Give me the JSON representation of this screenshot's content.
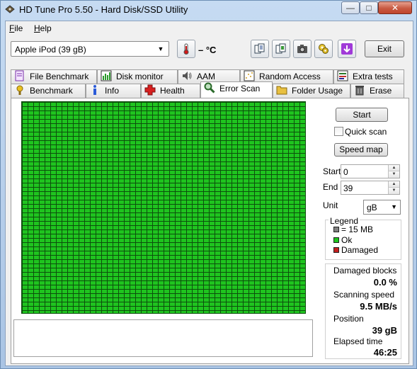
{
  "window": {
    "title": "HD Tune Pro 5.50 - Hard Disk/SSD Utility",
    "min_glyph": "—",
    "max_glyph": "□",
    "close_glyph": "✕"
  },
  "menu": {
    "file_ul": "F",
    "file_rest": "ile",
    "help_ul": "H",
    "help_rest": "elp"
  },
  "toolbar": {
    "drive": "Apple   iPod (39 gB)",
    "temperature": "– °C",
    "exit_label": "Exit",
    "icons": [
      "thermometer-icon",
      "copy-text-icon",
      "copy-info-icon",
      "screenshot-icon",
      "options-icon",
      "save-icon"
    ]
  },
  "tabs_top": [
    {
      "label": "File Benchmark",
      "icon": "file-benchmark-icon"
    },
    {
      "label": "Disk monitor",
      "icon": "disk-monitor-icon"
    },
    {
      "label": "AAM",
      "icon": "aam-speaker-icon"
    },
    {
      "label": "Random Access",
      "icon": "random-access-icon"
    },
    {
      "label": "Extra tests",
      "icon": "extra-tests-icon"
    }
  ],
  "tabs_bottom": [
    {
      "label": "Benchmark",
      "icon": "benchmark-icon"
    },
    {
      "label": "Info",
      "icon": "info-icon"
    },
    {
      "label": "Health",
      "icon": "health-cross-icon"
    },
    {
      "label": "Error Scan",
      "icon": "magnifier-icon",
      "active": true
    },
    {
      "label": "Folder Usage",
      "icon": "folder-icon"
    },
    {
      "label": "Erase",
      "icon": "trash-icon"
    }
  ],
  "scan": {
    "start_label": "Start",
    "quick_scan_label": "Quick scan",
    "quick_scan_checked": false,
    "speed_map_label": "Speed map",
    "start_field_label": "Start",
    "start_value": "0",
    "end_field_label": "End",
    "end_value": "39",
    "unit_label": "Unit",
    "unit_value": "gB",
    "legend": {
      "title": "Legend",
      "items": [
        {
          "label": "= 15 MB",
          "color": "#808080"
        },
        {
          "label": "Ok",
          "color": "#1fc41f"
        },
        {
          "label": "Damaged",
          "color": "#c41f1f"
        }
      ]
    },
    "stats": {
      "damaged_label": "Damaged blocks",
      "damaged_value": "0.0 %",
      "speed_label": "Scanning speed",
      "speed_value": "9.5 MB/s",
      "position_label": "Position",
      "position_value": "39 gB",
      "elapsed_label": "Elapsed time",
      "elapsed_value": "46:25"
    },
    "grid_color": "#1fc41f",
    "grid_line_color": "#0d4f0d"
  }
}
